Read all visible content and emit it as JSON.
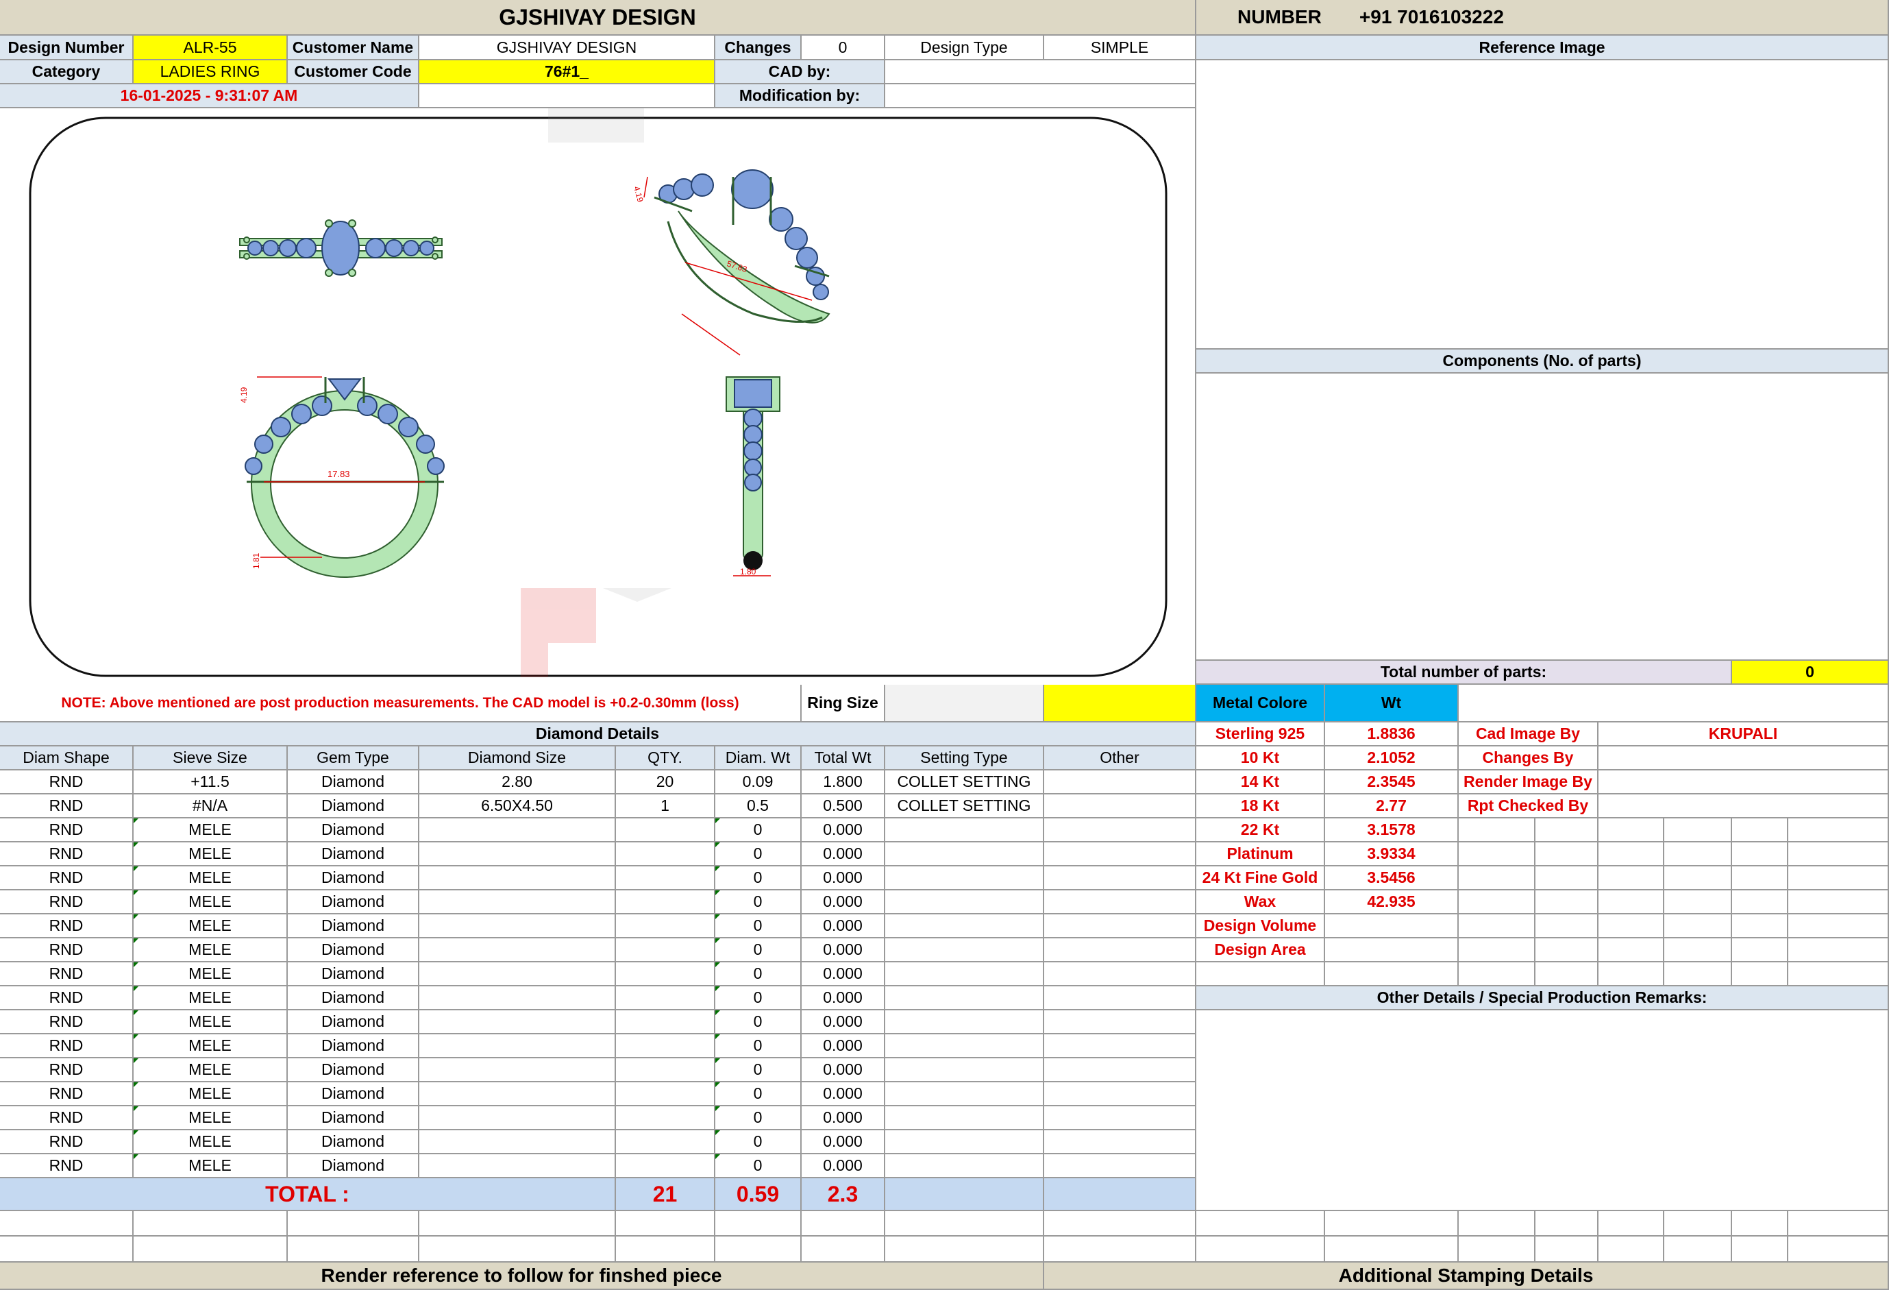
{
  "header": {
    "title": "GJSHIVAY DESIGN",
    "number_label": "NUMBER",
    "number_value": "+91 7016103222"
  },
  "info": {
    "design_number_label": "Design Number",
    "design_number": "ALR-55",
    "customer_name_label": "Customer Name",
    "customer_name": "GJSHIVAY DESIGN",
    "changes_label": "Changes",
    "changes": "0",
    "design_type_label": "Design Type",
    "design_type": "SIMPLE",
    "category_label": "Category",
    "category": "LADIES RING",
    "customer_code_label": "Customer Code",
    "customer_code": "76#1_",
    "cad_by_label": "CAD by:",
    "cad_by": "",
    "modification_by_label": "Modification by:",
    "modification_by": "",
    "date": "16-01-2025 - 9:31:07 AM"
  },
  "cad": {
    "dim_top_height": "4.19",
    "dim_length": "57.83",
    "dim_front_height": "4.19",
    "dim_inner_diameter": "17.83",
    "dim_shank_height": "1.81",
    "dim_shank_width": "1.80"
  },
  "note": "NOTE: Above mentioned are post production measurements. The CAD model is +0.2-0.30mm (loss)",
  "ring_size_label": "Ring Size",
  "ring_size": "",
  "diamond": {
    "title": "Diamond Details",
    "headers": [
      "Diam Shape",
      "Sieve Size",
      "Gem Type",
      "Diamond Size",
      "QTY.",
      "Diam. Wt",
      "Total Wt",
      "Setting Type",
      "Other"
    ],
    "rows": [
      [
        "RND",
        "+11.5",
        "Diamond",
        "2.80",
        "20",
        "0.09",
        "1.800",
        "COLLET SETTING",
        ""
      ],
      [
        "RND",
        "#N/A",
        "Diamond",
        "6.50X4.50",
        "1",
        "0.5",
        "0.500",
        "COLLET SETTING",
        ""
      ],
      [
        "RND",
        "MELE",
        "Diamond",
        "",
        "",
        "0",
        "0.000",
        "",
        ""
      ],
      [
        "RND",
        "MELE",
        "Diamond",
        "",
        "",
        "0",
        "0.000",
        "",
        ""
      ],
      [
        "RND",
        "MELE",
        "Diamond",
        "",
        "",
        "0",
        "0.000",
        "",
        ""
      ],
      [
        "RND",
        "MELE",
        "Diamond",
        "",
        "",
        "0",
        "0.000",
        "",
        ""
      ],
      [
        "RND",
        "MELE",
        "Diamond",
        "",
        "",
        "0",
        "0.000",
        "",
        ""
      ],
      [
        "RND",
        "MELE",
        "Diamond",
        "",
        "",
        "0",
        "0.000",
        "",
        ""
      ],
      [
        "RND",
        "MELE",
        "Diamond",
        "",
        "",
        "0",
        "0.000",
        "",
        ""
      ],
      [
        "RND",
        "MELE",
        "Diamond",
        "",
        "",
        "0",
        "0.000",
        "",
        ""
      ],
      [
        "RND",
        "MELE",
        "Diamond",
        "",
        "",
        "0",
        "0.000",
        "",
        ""
      ],
      [
        "RND",
        "MELE",
        "Diamond",
        "",
        "",
        "0",
        "0.000",
        "",
        ""
      ],
      [
        "RND",
        "MELE",
        "Diamond",
        "",
        "",
        "0",
        "0.000",
        "",
        ""
      ],
      [
        "RND",
        "MELE",
        "Diamond",
        "",
        "",
        "0",
        "0.000",
        "",
        ""
      ],
      [
        "RND",
        "MELE",
        "Diamond",
        "",
        "",
        "0",
        "0.000",
        "",
        ""
      ],
      [
        "RND",
        "MELE",
        "Diamond",
        "",
        "",
        "0",
        "0.000",
        "",
        ""
      ],
      [
        "RND",
        "MELE",
        "Diamond",
        "",
        "",
        "0",
        "0.000",
        "",
        ""
      ]
    ],
    "total_label": "TOTAL :",
    "total_qty": "21",
    "total_diam_wt": "0.59",
    "total_wt": "2.3"
  },
  "right": {
    "reference_image": "Reference Image",
    "components": "Components (No. of parts)",
    "total_parts_label": "Total number of parts:",
    "total_parts": "0",
    "metal_colore": "Metal Colore",
    "wt": "Wt",
    "metals": [
      {
        "name": "Sterling 925",
        "wt": "1.8836"
      },
      {
        "name": "10 Kt",
        "wt": "2.1052"
      },
      {
        "name": "14 Kt",
        "wt": "2.3545"
      },
      {
        "name": "18 Kt",
        "wt": "2.77"
      },
      {
        "name": "22 Kt",
        "wt": "3.1578"
      },
      {
        "name": "Platinum",
        "wt": "3.9334"
      },
      {
        "name": "24 Kt Fine Gold",
        "wt": "3.5456"
      },
      {
        "name": "Wax",
        "wt": "42.935"
      },
      {
        "name": "Design Volume",
        "wt": ""
      },
      {
        "name": "Design Area",
        "wt": ""
      }
    ],
    "roles": [
      {
        "label": "Cad Image By",
        "value": "KRUPALI"
      },
      {
        "label": "Changes By",
        "value": ""
      },
      {
        "label": "Render Image By",
        "value": ""
      },
      {
        "label": "Rpt Checked By",
        "value": ""
      }
    ],
    "other_details": "Other Details / Special Production Remarks:"
  },
  "footer": {
    "render_ref": "Render reference to follow for finshed piece",
    "stamping": "Additional Stamping Details"
  },
  "colors": {
    "gem": "#7f9fdc",
    "metal": "#b4e6b4",
    "dim": "#e00000",
    "yellow": "#ffff00",
    "header": "#ddd8c5",
    "label": "#dce6f0"
  }
}
